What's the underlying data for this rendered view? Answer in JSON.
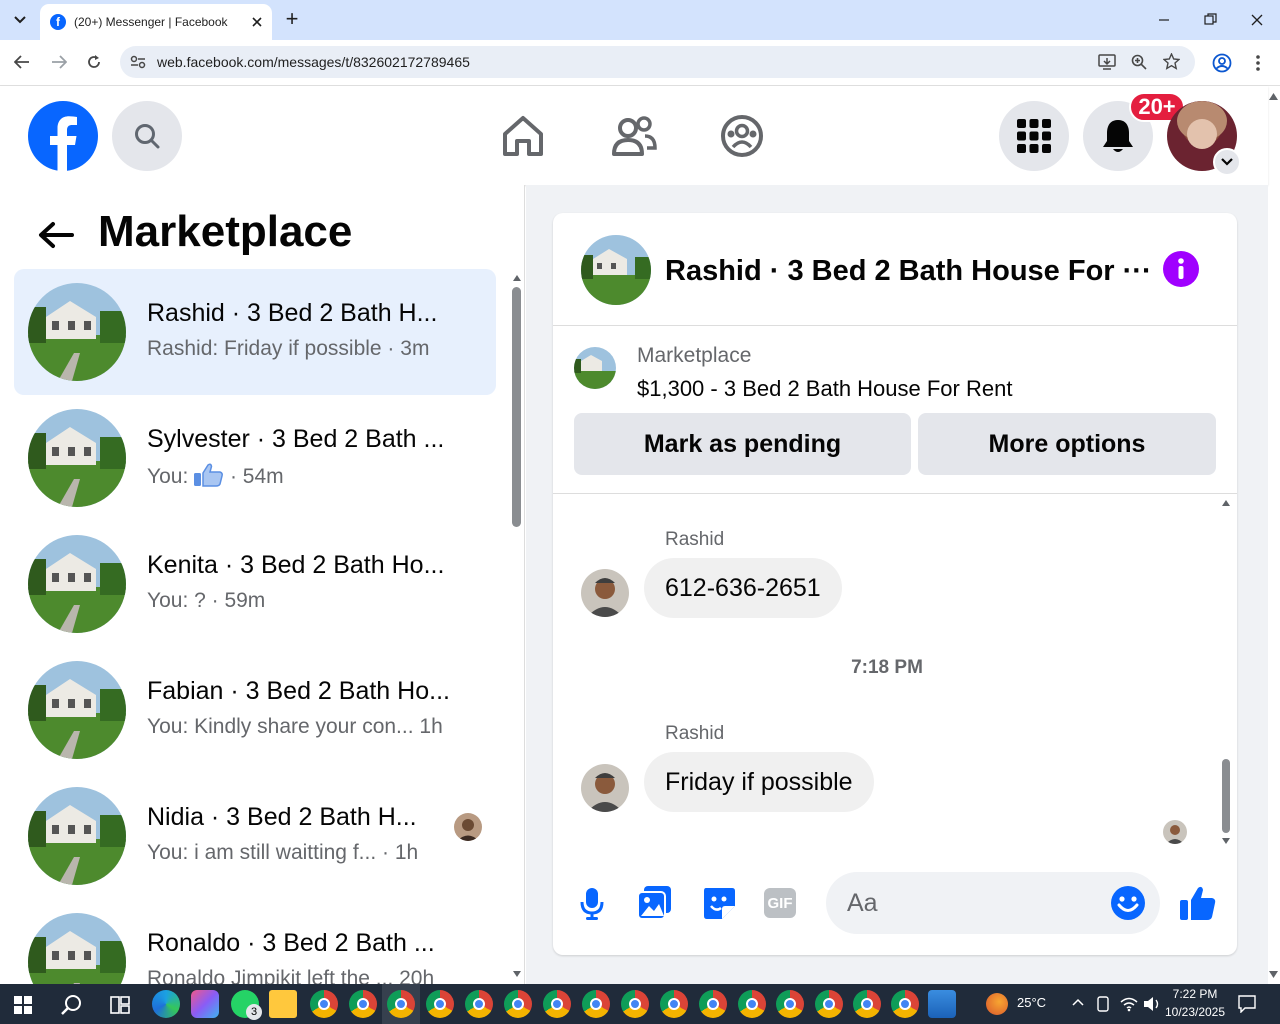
{
  "browser": {
    "tab_title": "(20+) Messenger | Facebook",
    "url": "web.facebook.com/messages/t/832602172789465",
    "new_tab": "+"
  },
  "header": {
    "notifications_badge": "20+"
  },
  "sidebar": {
    "title": "Marketplace",
    "conversations": [
      {
        "name": "Rashid · 3 Bed 2 Bath H...",
        "snippet": "Rashid: Friday if possible · 3m",
        "selected": true
      },
      {
        "name": "Sylvester · 3 Bed 2 Bath ...",
        "snippet_prefix": "You:",
        "snippet_suffix": "· 54m"
      },
      {
        "name": "Kenita · 3 Bed 2 Bath Ho...",
        "snippet": "You: ? · 59m"
      },
      {
        "name": "Fabian · 3 Bed 2 Bath Ho...",
        "snippet": "You: Kindly share your con...  1h"
      },
      {
        "name": "Nidia · 3 Bed 2 Bath H...",
        "snippet": "You: i am still waitting f... · 1h"
      },
      {
        "name": "Ronaldo · 3 Bed 2 Bath ...",
        "snippet": "Ronaldo Jimpikit left the ... 20h"
      }
    ]
  },
  "chat": {
    "title": "Rashid · 3 Bed 2 Bath House For ···",
    "listing_label": "Marketplace",
    "listing_title": "$1,300 - 3 Bed 2 Bath House For Rent",
    "mark_pending": "Mark as pending",
    "more_options": "More options",
    "messages": [
      {
        "sender": "Rashid",
        "text": "612-636-2651"
      },
      {
        "sender": "Rashid",
        "text": "Friday if possible"
      }
    ],
    "timestamp": "7:18 PM",
    "composer_placeholder": "Aa"
  },
  "taskbar": {
    "weather": "25°C",
    "time": "7:22 PM",
    "date": "10/23/2025",
    "whatsapp_badge": "3"
  }
}
